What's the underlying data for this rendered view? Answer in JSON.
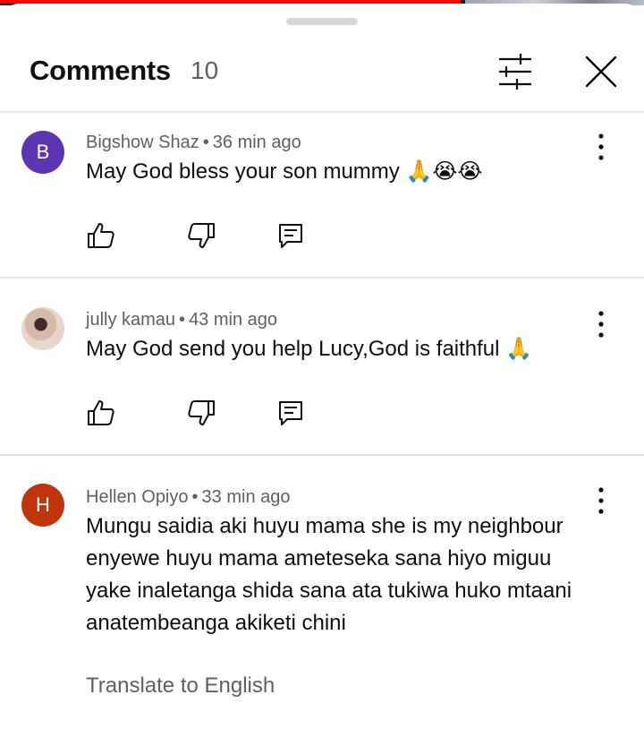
{
  "header": {
    "title": "Comments",
    "count": "10",
    "filter_icon": "tune-icon",
    "close_icon": "close-icon"
  },
  "comments": [
    {
      "author": "Bigshow Shaz",
      "time": "36 min ago",
      "text": "May God bless your son mummy 🙏😭😭",
      "avatar": {
        "letter": "B",
        "color": "#5e35b1"
      }
    },
    {
      "author": "jully kamau",
      "time": "43 min ago",
      "text": "May God send you help Lucy,God is faithful 🙏",
      "avatar": {
        "letter": "",
        "color": "#c8a89a"
      }
    },
    {
      "author": "Hellen Opiyo",
      "time": "33 min ago",
      "text": "Mungu saidia aki huyu mama she is my neighbour enyewe huyu mama ameteseka sana hiyo miguu yake inaletanga shida sana ata tukiwa huko mtaani anatembeanga akiketi chini",
      "avatar": {
        "letter": "H",
        "color": "#bf360c"
      },
      "translate_label": "Translate to English"
    }
  ],
  "separator": "•",
  "colors": {
    "accent": "#ff0000",
    "meta": "#606060",
    "text": "#0f0f0f"
  }
}
